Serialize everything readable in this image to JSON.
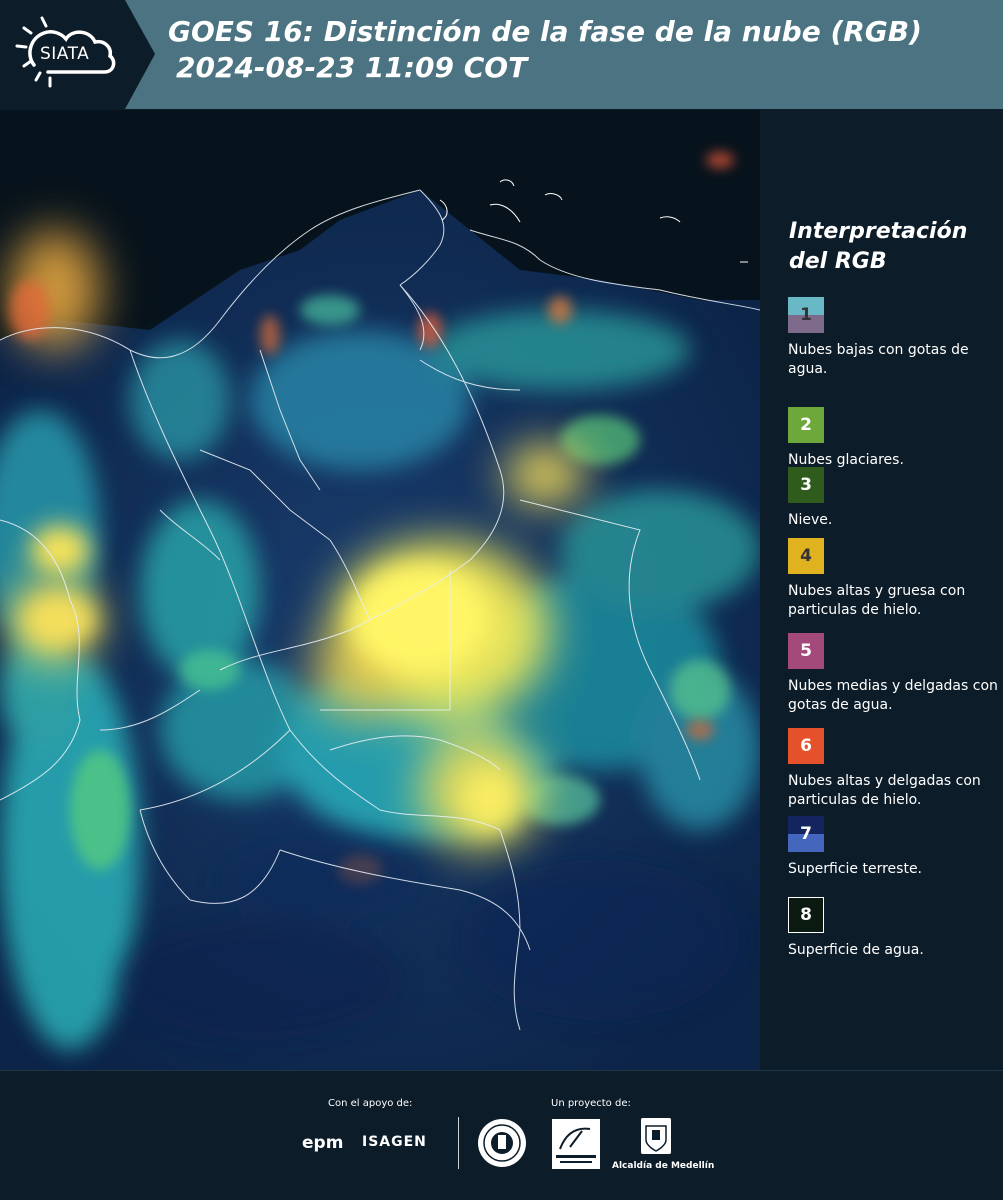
{
  "header": {
    "logo_text": "SIATA",
    "title_line1": "GOES 16: Distinción de la fase de la nube (RGB)",
    "title_line2": "2024-08-23 11:09 COT"
  },
  "legend": {
    "title": "Interpretación del RGB",
    "items": [
      {
        "number": "1",
        "label": "Nubes bajas con gotas de agua.",
        "color_top": "#68b8c6",
        "color_bottom": "#7e6a8a",
        "text_color": "#333333"
      },
      {
        "number": "2",
        "label": "Nubes glaciares.",
        "color_top": "#6ea73a",
        "color_bottom": "#6ea73a",
        "text_color": "#ffffff"
      },
      {
        "number": "3",
        "label": "Nieve.",
        "color_top": "#2f5b1c",
        "color_bottom": "#2f5b1c",
        "text_color": "#ffffff"
      },
      {
        "number": "4",
        "label": "Nubes altas y gruesa con particulas de hielo.",
        "color_top": "#e0b21f",
        "color_bottom": "#e0b21f",
        "text_color": "#333333"
      },
      {
        "number": "5",
        "label": "Nubes medias y delgadas con gotas de agua.",
        "color_top": "#a34a7a",
        "color_bottom": "#a34a7a",
        "text_color": "#ffffff"
      },
      {
        "number": "6",
        "label": "Nubes altas y delgadas con particulas de hielo.",
        "color_top": "#e5512a",
        "color_bottom": "#e5512a",
        "text_color": "#ffffff"
      },
      {
        "number": "7",
        "label": "Superficie terreste.",
        "color_top": "#13245e",
        "color_bottom": "#4467bd",
        "text_color": "#ffffff"
      },
      {
        "number": "8",
        "label": "Superficie de agua.",
        "color_top": "#0a1a10",
        "color_bottom": "#0a1a10",
        "text_color": "#ffffff",
        "border": "#ffffff"
      }
    ]
  },
  "footer": {
    "support_label": "Con el apoyo de:",
    "project_label": "Un proyecto de:",
    "epm": "epm",
    "isagen": "ISAGEN",
    "alcaldia": "Alcaldía de Medellín"
  }
}
